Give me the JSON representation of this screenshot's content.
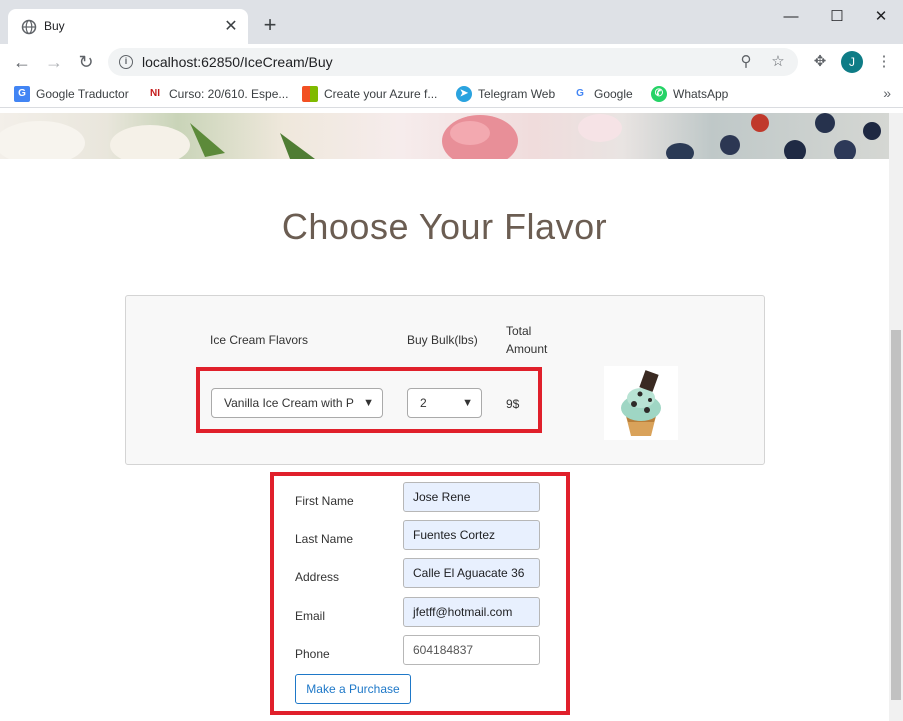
{
  "browser": {
    "tab_title": "Buy",
    "url": "localhost:62850/IceCream/Buy",
    "profile_initial": "J",
    "bookmarks": [
      {
        "label": "Google Traductor",
        "icon": "google-translate-icon",
        "color": "#4285f4"
      },
      {
        "label": "Curso: 20/610. Espe...",
        "icon": "ni-icon",
        "color": "#c41a1a"
      },
      {
        "label": "Create your Azure f...",
        "icon": "microsoft-icon",
        "color": "#f25022"
      },
      {
        "label": "Telegram Web",
        "icon": "telegram-icon",
        "color": "#2aa3df"
      },
      {
        "label": "Google",
        "icon": "google-icon",
        "color": "#4285f4"
      },
      {
        "label": "WhatsApp",
        "icon": "whatsapp-icon",
        "color": "#25d366"
      }
    ]
  },
  "page": {
    "title": "Choose Your Flavor",
    "columns": {
      "flavors": "Ice Cream Flavors",
      "bulk": "Buy Bulk(lbs)",
      "total": "Total Amount"
    },
    "flavor_selected": "Vanilla Ice Cream with P",
    "bulk_selected": "2",
    "total_value": "9$"
  },
  "form": {
    "fields": [
      {
        "label": "First Name",
        "value": "Jose Rene"
      },
      {
        "label": "Last Name",
        "value": "Fuentes Cortez"
      },
      {
        "label": "Address",
        "value": "Calle El Aguacate 36"
      },
      {
        "label": "Email",
        "value": "jfetff@hotmail.com"
      },
      {
        "label": "Phone",
        "value": "604184837"
      }
    ],
    "submit_label": "Make a Purchase"
  },
  "colors": {
    "highlight": "#e0202b",
    "title": "#6b5d52",
    "button_accent": "#1e78c8"
  }
}
